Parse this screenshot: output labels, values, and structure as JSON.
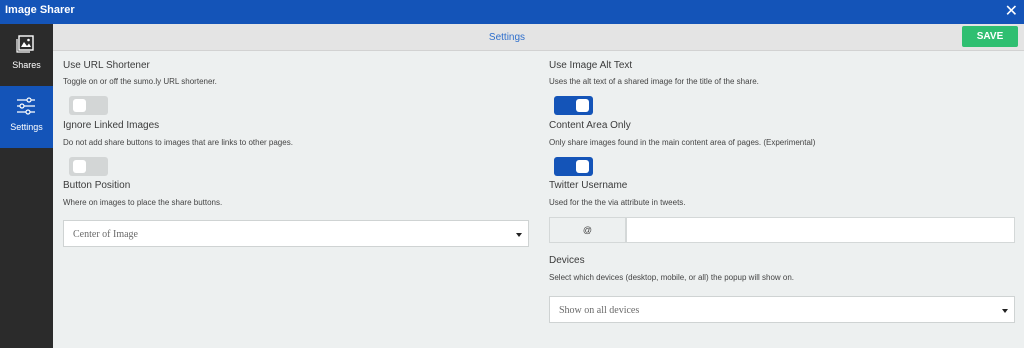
{
  "app": {
    "title": "Image Sharer",
    "close_icon": "close-icon"
  },
  "sidebar": {
    "items": [
      {
        "label": "Shares",
        "icon": "image-icon",
        "active": false
      },
      {
        "label": "Settings",
        "icon": "sliders-icon",
        "active": true
      }
    ]
  },
  "header": {
    "title": "Settings",
    "save_label": "SAVE"
  },
  "settings": {
    "url_shortener": {
      "label": "Use URL Shortener",
      "description": "Toggle on or off the sumo.ly URL shortener.",
      "enabled": false
    },
    "ignore_linked": {
      "label": "Ignore Linked Images",
      "description": "Do not add share buttons to images that are links to other pages.",
      "enabled": false
    },
    "button_position": {
      "label": "Button Position",
      "description": "Where on images to place the share buttons.",
      "selected": "Center of Image"
    },
    "alt_text": {
      "label": "Use Image Alt Text",
      "description": "Uses the alt text of a shared image for the title of the share.",
      "enabled": true
    },
    "content_area": {
      "label": "Content Area Only",
      "description": "Only share images found in the main content area of pages. (Experimental)",
      "enabled": true
    },
    "twitter": {
      "label": "Twitter Username",
      "description": "Used for the the via attribute in tweets.",
      "prefix": "@",
      "value": ""
    },
    "devices": {
      "label": "Devices",
      "description": "Select which devices (desktop, mobile, or all) the popup will show on.",
      "selected": "Show on all devices"
    }
  },
  "colors": {
    "brand_blue": "#1454b8",
    "save_green": "#2fbf71",
    "sidebar_dark": "#2b2b2b"
  }
}
